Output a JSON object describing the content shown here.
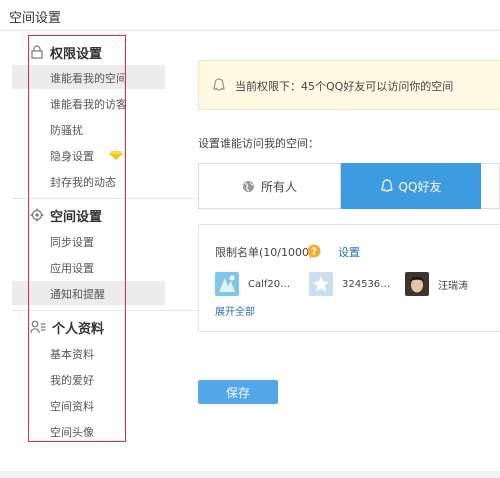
{
  "window": {
    "title": "空间设置"
  },
  "sidebar": {
    "sections": [
      {
        "title": "权限设置",
        "icon": "lock-icon",
        "items": [
          {
            "label": "谁能看我的空间",
            "active": true
          },
          {
            "label": "谁能看我的访客",
            "active": false
          },
          {
            "label": "防骚扰",
            "active": false
          },
          {
            "label": "隐身设置",
            "active": false,
            "badge": "diamond-icon"
          },
          {
            "label": "封存我的动态",
            "active": false
          }
        ]
      },
      {
        "title": "空间设置",
        "icon": "gear-icon",
        "items": [
          {
            "label": "同步设置",
            "active": false
          },
          {
            "label": "应用设置",
            "active": false
          },
          {
            "label": "通知和提醒",
            "active": true
          }
        ]
      },
      {
        "title": "个人资料",
        "icon": "profile-icon",
        "items": [
          {
            "label": "基本资料",
            "active": false
          },
          {
            "label": "我的爱好",
            "active": false
          },
          {
            "label": "空间资料",
            "active": false
          },
          {
            "label": "空间头像",
            "active": false
          }
        ]
      }
    ]
  },
  "main": {
    "notice": {
      "text": "当前权限下：45个QQ好友可以访问你的空间",
      "icon": "qq-penguin-icon"
    },
    "prompt": "设置谁能访问我的空间：",
    "options": [
      {
        "label": "所有人",
        "icon": "globe-icon",
        "selected": false
      },
      {
        "label": "QQ好友",
        "icon": "qq-penguin-icon",
        "selected": true
      }
    ],
    "limits": {
      "title": "限制名单(10/1000)",
      "help_icon": "question-icon",
      "settings_label": "设置",
      "friends": [
        {
          "name": "Calf20…"
        },
        {
          "name": "324536…"
        },
        {
          "name": "汪瑞涛"
        }
      ],
      "expand_label": "展开全部"
    },
    "save_label": "保存"
  },
  "colors": {
    "accent": "#3d9be0",
    "save": "#53a7e8",
    "annotation": "#e0352d",
    "notice_bg": "#fff8e3"
  }
}
